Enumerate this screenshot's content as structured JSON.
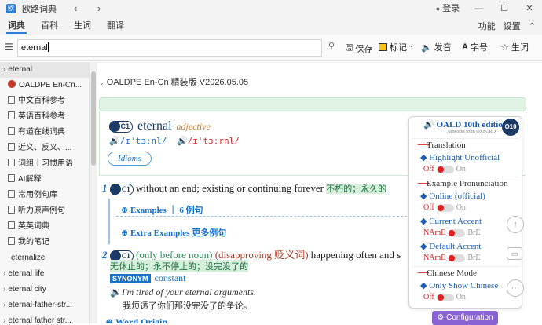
{
  "app": {
    "title": "欧路词典",
    "back": "‹",
    "forward": "›",
    "logo": "欧"
  },
  "titlebar": {
    "login": "登录",
    "min": "—",
    "max": "☐",
    "close": "✕"
  },
  "menubar": {
    "tabs": [
      "词典",
      "百科",
      "生词",
      "翻译"
    ],
    "right": [
      "功能",
      "设置"
    ],
    "collapse": "⌃"
  },
  "toolbar": {
    "search_value": "eternal",
    "save": "保存",
    "mark": "标记",
    "pronounce": "发音",
    "font": "字号",
    "wordbook": "生词",
    "more": "⌄"
  },
  "sidebar": {
    "items": [
      {
        "label": "eternal",
        "kind": "expand",
        "selected": true
      },
      {
        "label": "OALDPE En-Cn...",
        "kind": "oald"
      },
      {
        "label": "中文百科参考",
        "kind": "doc"
      },
      {
        "label": "英语百科参考",
        "kind": "doc"
      },
      {
        "label": "有道在线词典",
        "kind": "doc"
      },
      {
        "label": "近义、反义、...",
        "kind": "doc"
      },
      {
        "label": "词组｜习惯用语",
        "kind": "doc"
      },
      {
        "label": "AI解释",
        "kind": "doc"
      },
      {
        "label": "常用例句库",
        "kind": "doc"
      },
      {
        "label": "听力原声例句",
        "kind": "doc"
      },
      {
        "label": "英英词典",
        "kind": "doc"
      },
      {
        "label": "我的笔记",
        "kind": "doc"
      },
      {
        "label": "eternalize",
        "kind": "plain"
      },
      {
        "label": "eternal life",
        "kind": "expand"
      },
      {
        "label": "eternal city",
        "kind": "expand"
      },
      {
        "label": "eternal-father-str...",
        "kind": "expand"
      },
      {
        "label": "eternal father str...",
        "kind": "expand"
      }
    ]
  },
  "entry": {
    "dict_title": "OALDPE En-Cn 精装版 V2026.05.05",
    "headword": "eternal",
    "pos": "adjective",
    "level": "C1",
    "pron_br": "/ɪˈtɜːnl/",
    "pron_us": "/ɪˈtɜːrnl/",
    "idioms": "Idioms",
    "sense1": {
      "num": "1",
      "level": "C1",
      "def": "without an end; existing or continuing forever",
      "cn": "不朽的；永久的",
      "examples": "Examples",
      "examples_cn": "6 例句",
      "extra": "Extra Examples",
      "extra_cn": "更多例句"
    },
    "sense2": {
      "num": "2",
      "level": "C1",
      "gram": "(only before noun)",
      "reg": "(disapproving",
      "reg_cn": "贬义词)",
      "def": "happening often and s",
      "cn": "无休止的；永不停止的；没完没了的",
      "syn_label": "SYNONYM",
      "syn": "constant",
      "ex": "I'm tired of your eternal arguments.",
      "ex_cn": "我烦透了你们那没完没了的争论。"
    },
    "word_origin": "Word Origin"
  },
  "popup": {
    "title": "OALD 10th edition",
    "subtitle": "Artworks from OXFORD",
    "badge": "O10",
    "translation": "Translation",
    "translation_val": "Highlight Unofficial",
    "pron": "Example Pronunciation",
    "pron_val": "Online (official)",
    "accent": "Current Accent",
    "default_accent": "Default Accent",
    "chinese": "Chinese Mode",
    "chinese_val": "Only Show Chinese",
    "off": "Off",
    "on": "On",
    "name": "NAmE",
    "bre": "BrE",
    "config": "Configuration"
  },
  "colors": {
    "accent": "#2a7ed9",
    "green": "#2e8b57",
    "red": "#d42b2b",
    "config": "#8a63d2"
  }
}
